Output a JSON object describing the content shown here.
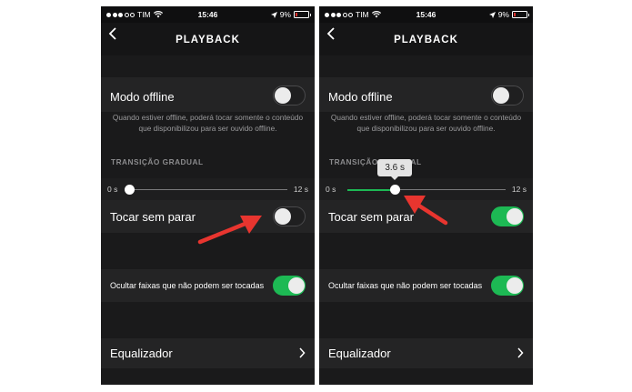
{
  "screens": [
    {
      "status": {
        "carrier": "TIM",
        "time": "15:46",
        "battery": "9%"
      },
      "nav": {
        "title": "PLAYBACK"
      },
      "offline": {
        "label": "Modo offline",
        "on": false
      },
      "offline_desc": "Quando estiver offline, poderá tocar somente o conteúdo que disponibilizou para ser ouvido offline.",
      "crossfade": {
        "header": "TRANSIÇÃO GRADUAL",
        "min_label": "0 s",
        "max_label": "12 s",
        "value_seconds": 0
      },
      "gapless": {
        "label": "Tocar sem parar",
        "on": false
      },
      "hide_unplayable": {
        "label": "Ocultar faixas que não podem ser tocadas",
        "on": true
      },
      "equalizer": {
        "label": "Equalizador"
      }
    },
    {
      "status": {
        "carrier": "TIM",
        "time": "15:46",
        "battery": "9%"
      },
      "nav": {
        "title": "PLAYBACK"
      },
      "offline": {
        "label": "Modo offline",
        "on": false
      },
      "offline_desc": "Quando estiver offline, poderá tocar somente o conteúdo que disponibilizou para ser ouvido offline.",
      "crossfade": {
        "header": "TRANSIÇÃO GRADUAL",
        "min_label": "0 s",
        "max_label": "12 s",
        "value_seconds": 3.6,
        "tooltip": "3.6 s"
      },
      "gapless": {
        "label": "Tocar sem parar",
        "on": true
      },
      "hide_unplayable": {
        "label": "Ocultar faixas que não podem ser tocadas",
        "on": true
      },
      "equalizer": {
        "label": "Equalizador"
      }
    }
  ],
  "colors": {
    "accent": "#1db954",
    "arrow": "#e8352f",
    "battery_low": "#e0322d"
  }
}
